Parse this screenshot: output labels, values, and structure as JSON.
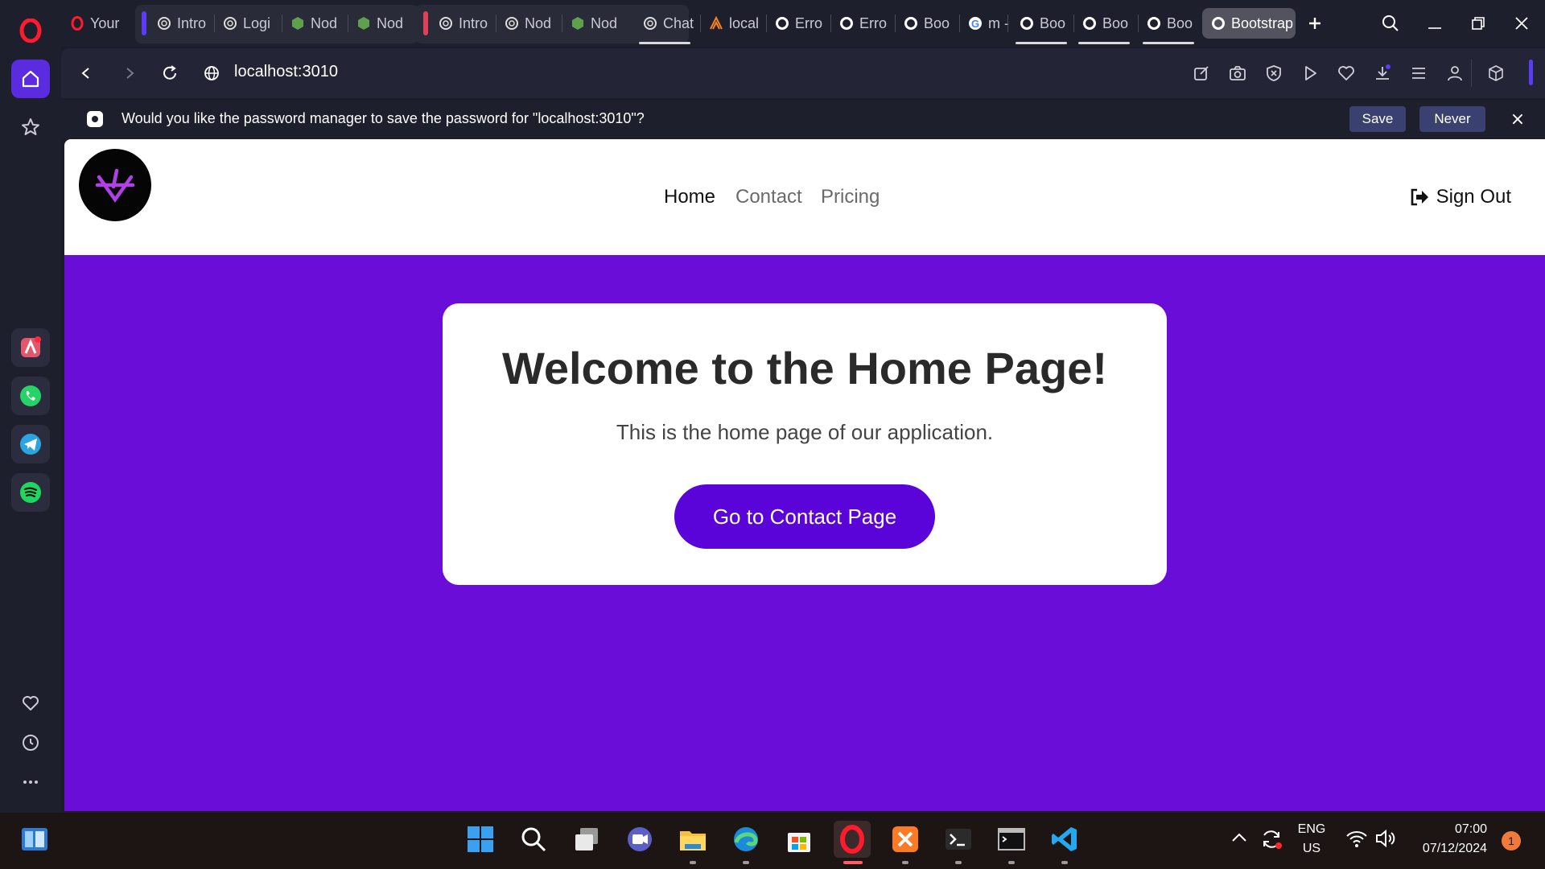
{
  "browser": {
    "tabs": [
      {
        "label": "Your",
        "icon": "opera-icon"
      },
      {
        "label": "Intro",
        "icon": "chatgpt-icon"
      },
      {
        "label": "Logi",
        "icon": "chatgpt-icon"
      },
      {
        "label": "Nod",
        "icon": "nodejs-icon"
      },
      {
        "label": "Nod",
        "icon": "nodejs-icon"
      },
      {
        "label": "Intro",
        "icon": "chatgpt-icon"
      },
      {
        "label": "Nod",
        "icon": "chatgpt-icon"
      },
      {
        "label": "Nod",
        "icon": "nodejs-icon"
      },
      {
        "label": "Chat",
        "icon": "chatgpt-icon"
      },
      {
        "label": "local",
        "icon": "xampp-icon"
      },
      {
        "label": "Erro",
        "icon": "globe-icon"
      },
      {
        "label": "Erro",
        "icon": "globe-icon"
      },
      {
        "label": "Boo",
        "icon": "globe-icon"
      },
      {
        "label": "m -",
        "icon": "google-icon"
      },
      {
        "label": "Boo",
        "icon": "globe-icon"
      },
      {
        "label": "Boo",
        "icon": "globe-icon"
      },
      {
        "label": "Boo",
        "icon": "globe-icon"
      },
      {
        "label": "Bootstrap",
        "icon": "globe-icon",
        "active": true
      }
    ],
    "url": "localhost:3010",
    "password_prompt": {
      "message": "Would you like the password manager to save the password for \"localhost:3010\"?",
      "save_label": "Save",
      "never_label": "Never",
      "close_label": "×"
    },
    "colors": {
      "accent": "#6a0dd9",
      "sidebar_home": "#5b2be0"
    }
  },
  "site": {
    "nav": {
      "home": "Home",
      "contact": "Contact",
      "pricing": "Pricing",
      "signout": "Sign Out"
    },
    "card": {
      "title": "Welcome to the Home Page!",
      "subtitle": "This is the home page of our application.",
      "button": "Go to Contact Page"
    }
  },
  "taskbar": {
    "lang_top": "ENG",
    "lang_bottom": "US",
    "time": "07:00",
    "date": "07/12/2024",
    "notification_count": "1"
  }
}
